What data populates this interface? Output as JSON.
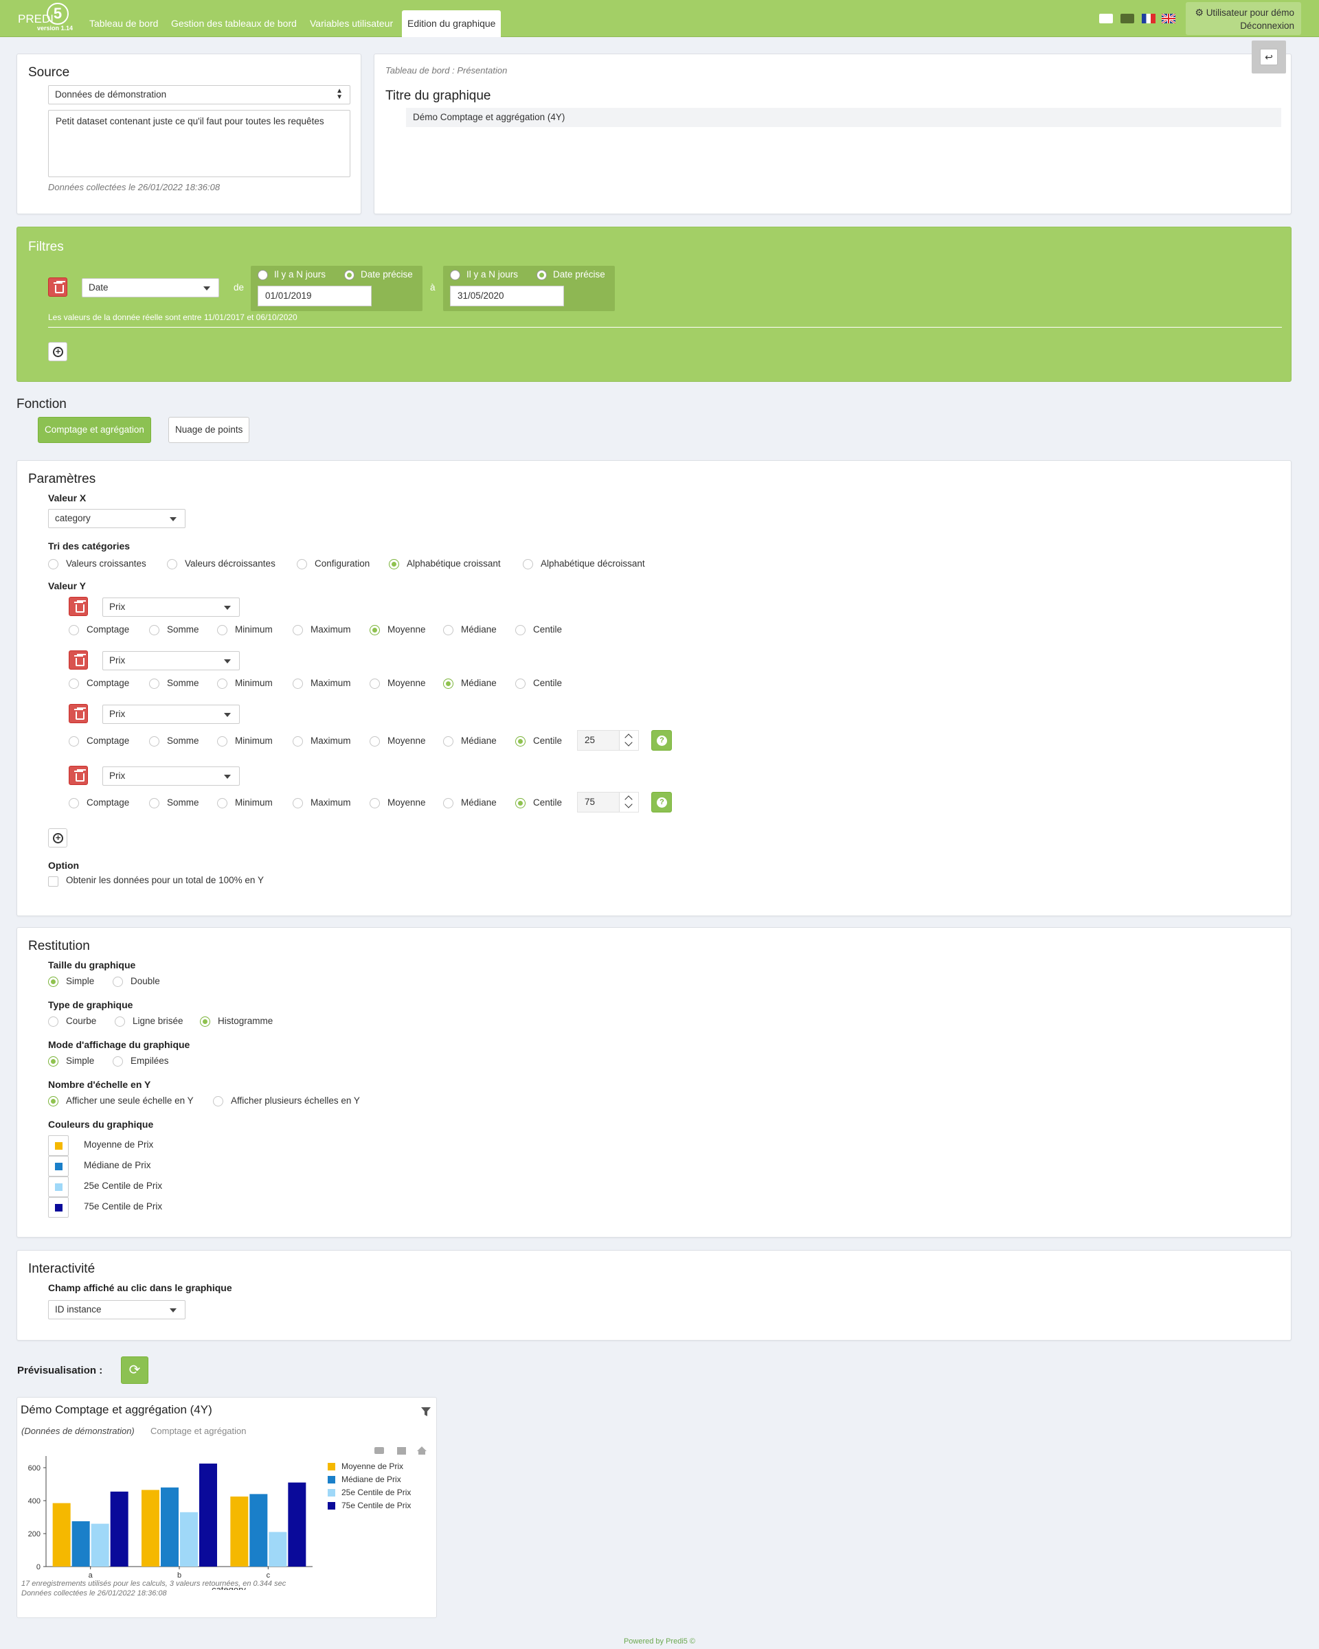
{
  "nav": {
    "brand": "PREDI",
    "brand_number": "5",
    "version": "version 1.14",
    "tabs": [
      "Tableau de bord",
      "Gestion des tableaux de bord",
      "Variables utilisateur",
      "Edition du graphique"
    ],
    "active_tab": "Edition du graphique",
    "user_label": "Utilisateur pour démo",
    "logout_label": "Déconnexion",
    "flags": [
      "white-flag",
      "green-flag",
      "fr-flag",
      "uk-flag"
    ]
  },
  "source": {
    "title": "Source",
    "selected": "Données de démonstration",
    "description": "Petit dataset contenant juste ce qu'il faut pour toutes les requêtes",
    "collected": "Données collectées le 26/01/2022 18:36:08"
  },
  "header_panel": {
    "breadcrumb": "Tableau de bord : Présentation",
    "title_label": "Titre du graphique",
    "title_value": "Démo Comptage et aggrégation (4Y)"
  },
  "filters": {
    "title": "Filtres",
    "field": "Date",
    "from_label": "de",
    "to_label": "à",
    "opt_n_days": "Il y a N jours",
    "opt_precise": "Date précise",
    "from_value": "01/01/2019",
    "to_value": "31/05/2020",
    "hint": "Les valeurs de la donnée réelle sont entre 11/01/2017 et 06/10/2020"
  },
  "fonction": {
    "title": "Fonction",
    "buttons": [
      "Comptage et agrégation",
      "Nuage de points"
    ],
    "active": "Comptage et agrégation"
  },
  "parametres": {
    "title": "Paramètres",
    "x_label": "Valeur X",
    "x_value": "category",
    "sort_label": "Tri des catégories",
    "sort_options": [
      "Valeurs croissantes",
      "Valeurs décroissantes",
      "Configuration",
      "Alphabétique croissant",
      "Alphabétique décroissant"
    ],
    "sort_selected": "Alphabétique croissant",
    "y_label": "Valeur Y",
    "agg_options": [
      "Comptage",
      "Somme",
      "Minimum",
      "Maximum",
      "Moyenne",
      "Médiane",
      "Centile"
    ],
    "y_values": [
      {
        "field": "Prix",
        "agg": "Moyenne",
        "centile": ""
      },
      {
        "field": "Prix",
        "agg": "Médiane",
        "centile": ""
      },
      {
        "field": "Prix",
        "agg": "Centile",
        "centile": "25"
      },
      {
        "field": "Prix",
        "agg": "Centile",
        "centile": "75"
      }
    ],
    "option_label": "Option",
    "option_text": "Obtenir les données pour un total de 100% en Y"
  },
  "restitution": {
    "title": "Restitution",
    "size_label": "Taille du graphique",
    "size_options": [
      "Simple",
      "Double"
    ],
    "size_selected": "Simple",
    "type_label": "Type de graphique",
    "type_options": [
      "Courbe",
      "Ligne brisée",
      "Histogramme"
    ],
    "type_selected": "Histogramme",
    "mode_label": "Mode d'affichage du graphique",
    "mode_options": [
      "Simple",
      "Empilées"
    ],
    "mode_selected": "Simple",
    "scale_label": "Nombre d'échelle en Y",
    "scale_options": [
      "Afficher une seule échelle en Y",
      "Afficher plusieurs échelles en Y"
    ],
    "scale_selected": "Afficher une seule échelle en Y",
    "colors_label": "Couleurs du graphique",
    "colors": [
      {
        "name": "Moyenne de Prix",
        "color": "#f5b800"
      },
      {
        "name": "Médiane de Prix",
        "color": "#1a7fc9"
      },
      {
        "name": "25e Centile de Prix",
        "color": "#9fd8f8"
      },
      {
        "name": "75e Centile de Prix",
        "color": "#0a0a9a"
      }
    ]
  },
  "interactivite": {
    "title": "Interactivité",
    "field_label": "Champ affiché au clic dans le graphique",
    "field_value": "ID instance"
  },
  "preview": {
    "label": "Prévisualisation :",
    "chart_title": "Démo Comptage et aggrégation (4Y)",
    "source_name": "(Données de démonstration)",
    "function_name": "Comptage et agrégation",
    "stats": "17 enregistrements utilisés pour les calculs, 3 valeurs retournées, en 0.344 sec",
    "collected": "Données collectées le 26/01/2022 18:36:08"
  },
  "chart_data": {
    "type": "bar",
    "categories": [
      "a",
      "b",
      "c"
    ],
    "xlabel": "category",
    "ylabel": "",
    "ylim": [
      0,
      650
    ],
    "yticks": [
      0,
      200,
      400,
      600
    ],
    "legend": "right",
    "series": [
      {
        "name": "Moyenne de Prix",
        "values": [
          385,
          465,
          425
        ],
        "color": "#f5b800"
      },
      {
        "name": "Médiane de Prix",
        "values": [
          275,
          480,
          440
        ],
        "color": "#1a7fc9"
      },
      {
        "name": "25e Centile de Prix",
        "values": [
          260,
          330,
          210
        ],
        "color": "#9fd8f8"
      },
      {
        "name": "75e Centile de Prix",
        "values": [
          455,
          625,
          510
        ],
        "color": "#0a0a9a"
      }
    ]
  },
  "footer": "Powered by Predi5 ©"
}
